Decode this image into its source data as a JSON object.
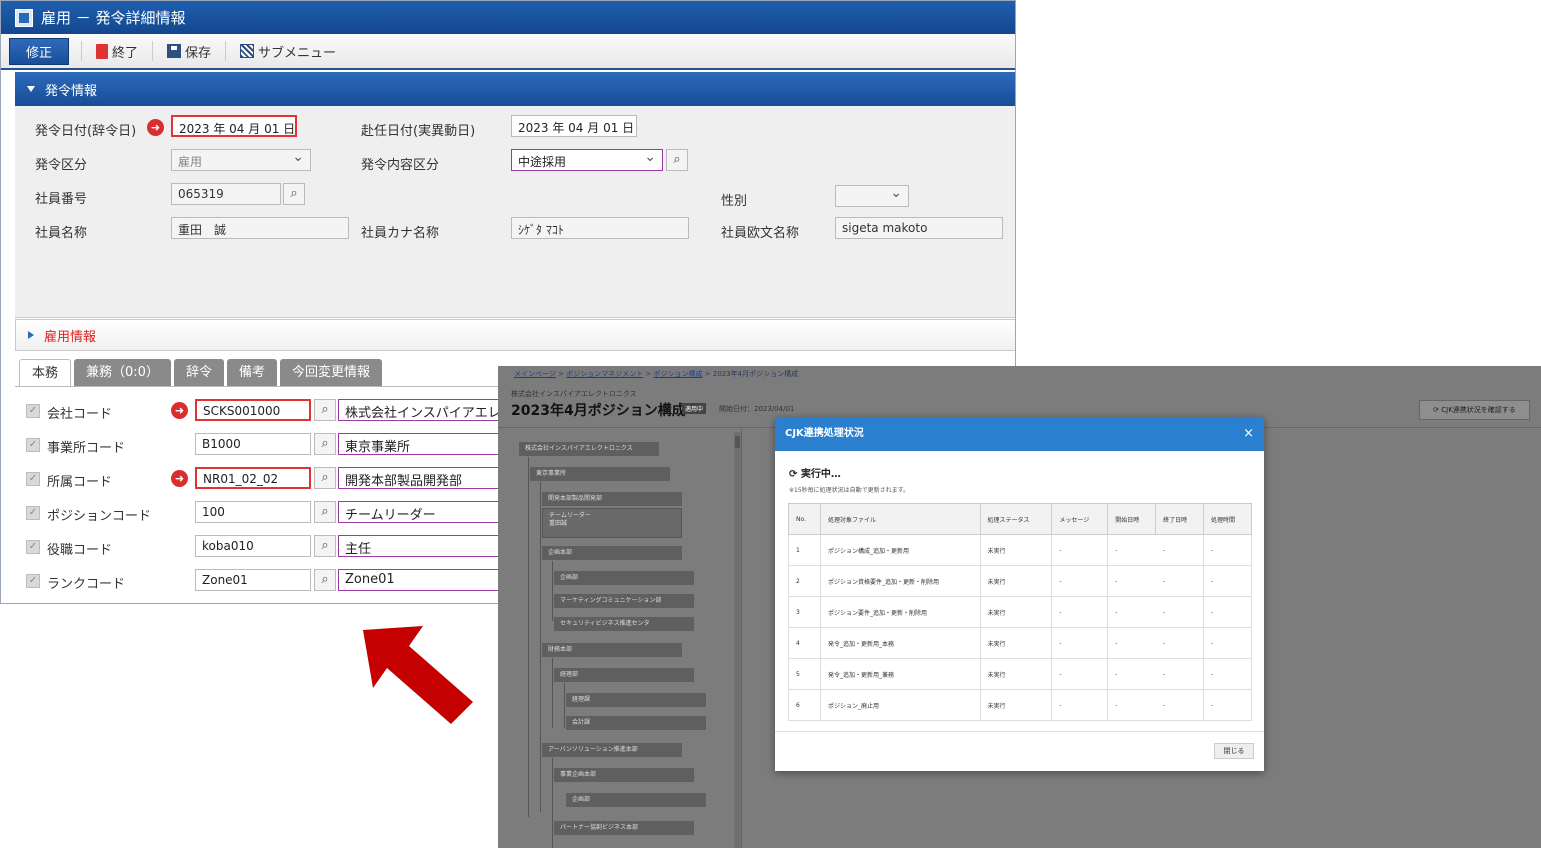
{
  "window": {
    "title": "雇用 － 発令詳細情報",
    "toolbar": {
      "edit": "修正",
      "exit": "終了",
      "save": "保存",
      "submenu": "サブメニュー"
    }
  },
  "section1": {
    "title": "発令情報",
    "issue_date_label": "発令日付(辞令日)",
    "issue_date": "2023 年 04 月 01 日",
    "assign_date_label": "赴任日付(実異動日)",
    "assign_date": "2023 年 04 月 01 日",
    "category_label": "発令区分",
    "category": "雇用",
    "content_label": "発令内容区分",
    "content": "中途採用",
    "emp_no_label": "社員番号",
    "emp_no": "065319",
    "gender_label": "性別",
    "gender": "",
    "name_label": "社員名称",
    "name": "重田　誠",
    "kana_label": "社員カナ名称",
    "kana": "ｼｹﾞﾀ ﾏｺﾄ",
    "roman_label": "社員欧文名称",
    "roman": "sigeta makoto"
  },
  "section2": {
    "title": "雇用情報"
  },
  "tabs": [
    "本務",
    "兼務（0:0）",
    "辞令",
    "備考",
    "今回変更情報"
  ],
  "codes": [
    {
      "label": "会社コード",
      "value": "SCKS001000",
      "name": "株式会社インスパイアエレクトロニクス"
    },
    {
      "label": "事業所コード",
      "value": "B1000",
      "name": "東京事業所"
    },
    {
      "label": "所属コード",
      "value": "NR01_02_02",
      "name": "開発本部製品開発部"
    },
    {
      "label": "ポジションコード",
      "value": "100",
      "name": "チームリーダー"
    },
    {
      "label": "役職コード",
      "value": "koba010",
      "name": "主任"
    },
    {
      "label": "ランクコード",
      "value": "Zone01",
      "name": "Zone01"
    }
  ],
  "shot": {
    "breadcrumb": [
      "メインページ",
      "ポジションマネジメント",
      "ポジション構成",
      "2023年4月ポジション構成"
    ],
    "company": "株式会社インスパイアエレクトロニクス",
    "title": "2023年4月ポジション構成",
    "badge": "適用中",
    "start_date": "開始日付：2023/04/01",
    "check_button": "CJK連携状況を確認する",
    "tree": [
      "株式会社インスパイアエレクトロニクス",
      "東京事業所",
      "開発本部製品開発部",
      "チームリーダー",
      "重田誠",
      "企画本部",
      "企画部",
      "マーケティングコミュニケーション部",
      "セキュリティビジネス推進センタ",
      "財務本部",
      "経理部",
      "経理課",
      "会計課",
      "アーバンソリューション推進本部",
      "事業企画本部",
      "企画部",
      "パートナー協創ビジネス本部"
    ],
    "dialog": {
      "title": "CJK連携処理状況",
      "close_x": "×",
      "running": "実行中…",
      "note": "※15秒毎に処理状況は自動で更新されます。",
      "headers": [
        "No.",
        "処理対象ファイル",
        "処理ステータス",
        "メッセージ",
        "開始日時",
        "終了日時",
        "処理時間"
      ],
      "rows": [
        [
          "1",
          "ポジション構成_追加・更新用",
          "未実行",
          "-",
          "-",
          "-",
          "-"
        ],
        [
          "2",
          "ポジション資格要件_追加・更新・削除用",
          "未実行",
          "-",
          "-",
          "-",
          "-"
        ],
        [
          "3",
          "ポジション要件_追加・更新・削除用",
          "未実行",
          "-",
          "-",
          "-",
          "-"
        ],
        [
          "4",
          "発令_追加・更新用_本務",
          "未実行",
          "-",
          "-",
          "-",
          "-"
        ],
        [
          "5",
          "発令_追加・更新用_兼務",
          "未実行",
          "-",
          "-",
          "-",
          "-"
        ],
        [
          "6",
          "ポジション_廃止用",
          "未実行",
          "-",
          "-",
          "-",
          "-"
        ]
      ],
      "close_button": "閉じる"
    }
  },
  "colors": {
    "accent": "#1a4e97",
    "dialog_header": "#2a7fcf",
    "required": "#e03333",
    "arrow": "#c40000"
  }
}
